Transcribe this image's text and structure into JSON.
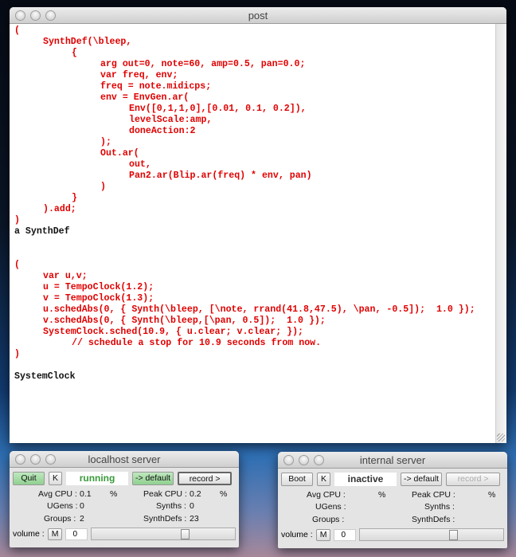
{
  "post": {
    "title": "post",
    "lines": [
      {
        "t": "(",
        "i": 0,
        "c": "red"
      },
      {
        "t": "SynthDef(\\bleep,",
        "i": 1,
        "c": "red"
      },
      {
        "t": "{",
        "i": 2,
        "c": "red"
      },
      {
        "t": "arg out=0, note=60, amp=0.5, pan=0.0;",
        "i": 3,
        "c": "red"
      },
      {
        "t": "var freq, env;",
        "i": 3,
        "c": "red"
      },
      {
        "t": "freq = note.midicps;",
        "i": 3,
        "c": "red"
      },
      {
        "t": "env = EnvGen.ar(",
        "i": 3,
        "c": "red"
      },
      {
        "t": "Env([0,1,1,0],[0.01, 0.1, 0.2]),",
        "i": 4,
        "c": "red"
      },
      {
        "t": "levelScale:amp,",
        "i": 4,
        "c": "red"
      },
      {
        "t": "doneAction:2",
        "i": 4,
        "c": "red"
      },
      {
        "t": ");",
        "i": 3,
        "c": "red"
      },
      {
        "t": "Out.ar(",
        "i": 3,
        "c": "red"
      },
      {
        "t": "out,",
        "i": 4,
        "c": "red"
      },
      {
        "t": "Pan2.ar(Blip.ar(freq) * env, pan)",
        "i": 4,
        "c": "red"
      },
      {
        "t": ")",
        "i": 3,
        "c": "red"
      },
      {
        "t": "}",
        "i": 2,
        "c": "red"
      },
      {
        "t": ").add;",
        "i": 1,
        "c": "red"
      },
      {
        "t": ")",
        "i": 0,
        "c": "red"
      },
      {
        "t": "a SynthDef",
        "i": 0,
        "c": "blk"
      },
      {
        "t": "",
        "i": 0,
        "c": "blk"
      },
      {
        "t": "",
        "i": 0,
        "c": "blk"
      },
      {
        "t": "(",
        "i": 0,
        "c": "red"
      },
      {
        "t": "var u,v;",
        "i": 1,
        "c": "red"
      },
      {
        "t": "u = TempoClock(1.2);",
        "i": 1,
        "c": "red"
      },
      {
        "t": "v = TempoClock(1.3);",
        "i": 1,
        "c": "red"
      },
      {
        "t": "u.schedAbs(0, { Synth(\\bleep, [\\note, rrand(41.8,47.5), \\pan, -0.5]);  1.0 });",
        "i": 1,
        "c": "red"
      },
      {
        "t": "v.schedAbs(0, { Synth(\\bleep,[\\pan, 0.5]);  1.0 });",
        "i": 1,
        "c": "red"
      },
      {
        "t": "SystemClock.sched(10.9, { u.clear; v.clear; });",
        "i": 1,
        "c": "red"
      },
      {
        "t": "// schedule a stop for 10.9 seconds from now.",
        "i": 2,
        "c": "red"
      },
      {
        "t": ")",
        "i": 0,
        "c": "red"
      },
      {
        "t": "",
        "i": 0,
        "c": "blk"
      },
      {
        "t": "SystemClock",
        "i": 0,
        "c": "blk"
      }
    ]
  },
  "servers": [
    {
      "title": "localhost server",
      "boot": "Quit",
      "kill": "K",
      "status": "running",
      "default": "-> default",
      "record": "record >",
      "avg_cpu_label": "Avg CPU :",
      "avg_cpu": "0.1",
      "pct": "%",
      "peak_cpu_label": "Peak CPU :",
      "peak_cpu": "0.2",
      "ugens_label": "UGens :",
      "ugens": "0",
      "synths_label": "Synths :",
      "synths": "0",
      "groups_label": "Groups :",
      "groups": "2",
      "synthdefs_label": "SynthDefs :",
      "synthdefs": "23",
      "volume_label": "volume :",
      "mute": "M",
      "volume": "0",
      "status_color": "#3a9a3a"
    },
    {
      "title": "internal server",
      "boot": "Boot",
      "kill": "K",
      "status": "inactive",
      "default": "-> default",
      "record": "record >",
      "avg_cpu_label": "Avg CPU :",
      "avg_cpu": "",
      "pct": "%",
      "peak_cpu_label": "Peak CPU :",
      "peak_cpu": "",
      "ugens_label": "UGens :",
      "ugens": "",
      "synths_label": "Synths :",
      "synths": "",
      "groups_label": "Groups :",
      "groups": "",
      "synthdefs_label": "SynthDefs :",
      "synthdefs": "",
      "volume_label": "volume :",
      "mute": "M",
      "volume": "0",
      "status_color": "#333333"
    }
  ]
}
